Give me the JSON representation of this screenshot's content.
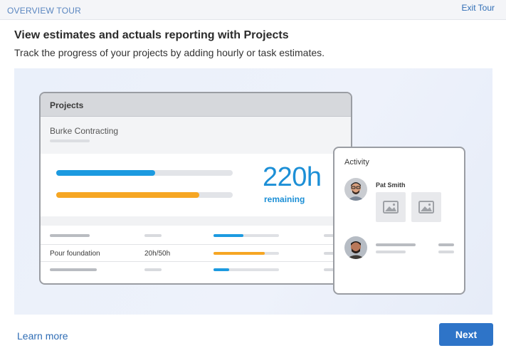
{
  "header": {
    "tour_label": "OVERVIEW TOUR",
    "exit_label": "Exit Tour"
  },
  "intro": {
    "title": "View estimates and actuals reporting with Projects",
    "subtitle": "Track the progress of your projects by adding hourly or task estimates."
  },
  "projects_card": {
    "title": "Projects",
    "client": "Burke Contracting",
    "progress_bars": [
      {
        "name": "hours",
        "color": "#1c9ae0",
        "fraction": 0.56
      },
      {
        "name": "budget",
        "color": "#f6a623",
        "fraction": 0.81
      }
    ],
    "remaining_value": "220h",
    "remaining_label": "remaining",
    "rows": [
      {
        "task": "",
        "hours": "",
        "color": "#1c9ae0",
        "fraction": 0.46
      },
      {
        "task": "Pour foundation",
        "hours": "20h/50h",
        "color": "#f6a623",
        "fraction": 0.78
      },
      {
        "task": "",
        "hours": "",
        "color": "#1c9ae0",
        "fraction": 0.24
      }
    ]
  },
  "activity_card": {
    "title": "Activity",
    "entries": [
      {
        "name": "Pat Smith",
        "attachments": [
          "image-placeholder-icon",
          "image-placeholder-icon"
        ]
      },
      {
        "name": ""
      }
    ]
  },
  "footer": {
    "learn_more": "Learn more",
    "next": "Next"
  },
  "colors": {
    "accent_blue": "#1c8fd6",
    "accent_orange": "#f6a623",
    "button_blue": "#2e74c8",
    "link_blue": "#2f6db5"
  }
}
